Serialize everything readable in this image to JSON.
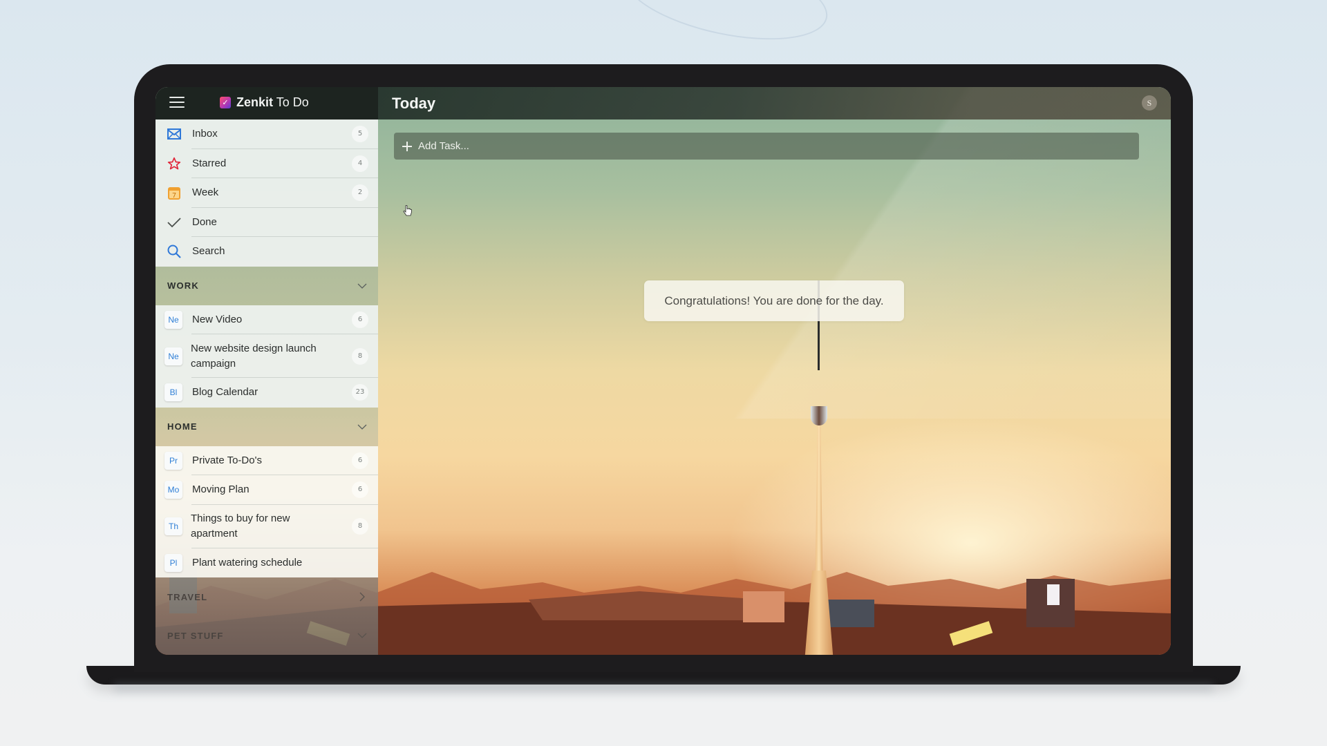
{
  "app": {
    "brand_bold": "Zenkit",
    "brand_light": " To Do",
    "logo_glyph": "✓",
    "avatar_initial": "S"
  },
  "header": {
    "title": "Today"
  },
  "sidebar": {
    "smart_lists": [
      {
        "label": "Inbox",
        "icon": "inbox-icon",
        "count": "5",
        "color": "#2f78d8"
      },
      {
        "label": "Starred",
        "icon": "star-icon",
        "count": "4",
        "color": "#e0263a"
      },
      {
        "label": "Week",
        "icon": "calendar-icon",
        "count": "2",
        "color": "#f0a030",
        "glyph": "7"
      },
      {
        "label": "Done",
        "icon": "check-icon",
        "count": "",
        "color": "#4a4f4c"
      },
      {
        "label": "Search",
        "icon": "search-icon",
        "count": "",
        "color": "#2f78d8"
      }
    ],
    "sections": [
      {
        "title": "WORK",
        "expanded": true,
        "lists": [
          {
            "badge": "Ne",
            "label": "New Video",
            "count": "6"
          },
          {
            "badge": "Ne",
            "label": "New website design launch campaign",
            "count": "8"
          },
          {
            "badge": "Bl",
            "label": "Blog Calendar",
            "count": "23"
          }
        ]
      },
      {
        "title": "HOME",
        "expanded": true,
        "lists": [
          {
            "badge": "Pr",
            "label": "Private To-Do's",
            "count": "6"
          },
          {
            "badge": "Mo",
            "label": "Moving Plan",
            "count": "6"
          },
          {
            "badge": "Th",
            "label": "Things to buy for new apartment",
            "count": "8"
          },
          {
            "badge": "Pl",
            "label": "Plant watering schedule",
            "count": ""
          }
        ]
      },
      {
        "title": "TRAVEL",
        "expanded": false,
        "lists": []
      },
      {
        "title": "PET STUFF",
        "expanded": true,
        "lists": []
      }
    ]
  },
  "main": {
    "add_task_placeholder": "Add Task...",
    "empty_message": "Congratulations! You are done for the day."
  }
}
